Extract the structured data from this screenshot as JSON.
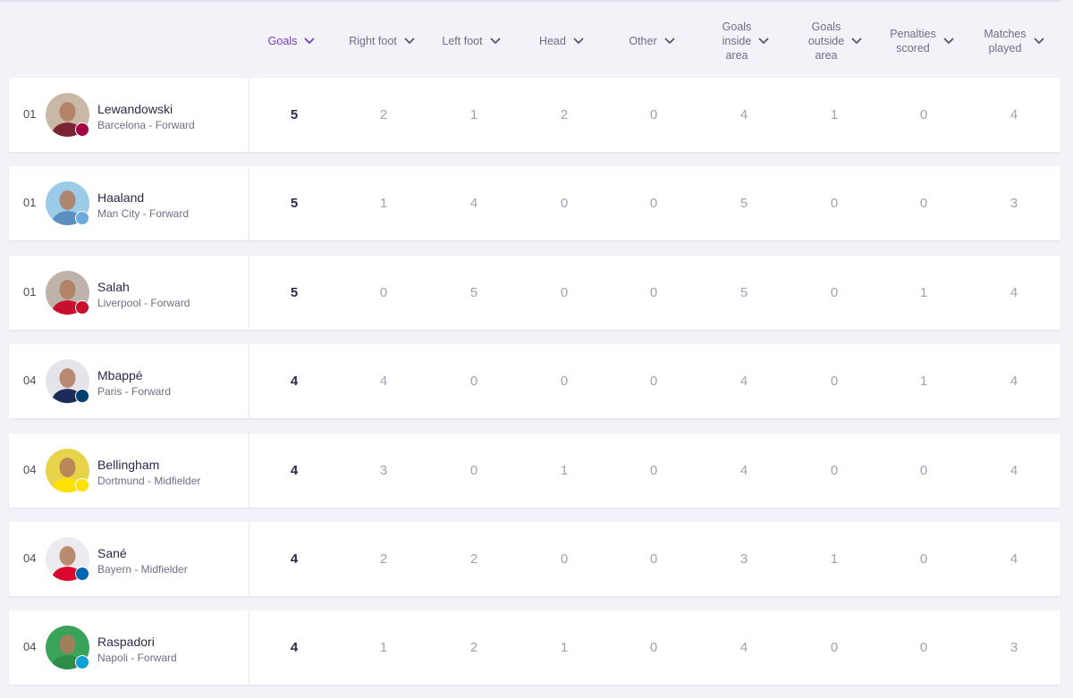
{
  "columns": [
    {
      "key": "goals",
      "label": "Goals",
      "active": true
    },
    {
      "key": "right_foot",
      "label": "Right foot",
      "active": false
    },
    {
      "key": "left_foot",
      "label": "Left foot",
      "active": false
    },
    {
      "key": "head",
      "label": "Head",
      "active": false
    },
    {
      "key": "other",
      "label": "Other",
      "active": false
    },
    {
      "key": "inside",
      "label": "Goals\ninside\narea",
      "active": false
    },
    {
      "key": "outside",
      "label": "Goals\noutside\narea",
      "active": false
    },
    {
      "key": "penalties",
      "label": "Penalties\nscored",
      "active": false
    },
    {
      "key": "matches",
      "label": "Matches\nplayed",
      "active": false
    }
  ],
  "rows": [
    {
      "rank": "01",
      "name": "Lewandowski",
      "team": "Barcelona - Forward",
      "stats": [
        "5",
        "2",
        "1",
        "2",
        "0",
        "4",
        "1",
        "0",
        "4"
      ],
      "avatar_color": "#c9b8a6",
      "shirt_color": "#7a2436",
      "badge_color": "#a50044",
      "badge_icon": "barcelona-crest-icon"
    },
    {
      "rank": "01",
      "name": "Haaland",
      "team": "Man City - Forward",
      "stats": [
        "5",
        "1",
        "4",
        "0",
        "0",
        "5",
        "0",
        "0",
        "3"
      ],
      "avatar_color": "#9ccbe8",
      "shirt_color": "#5b8fc0",
      "badge_color": "#6cabdd",
      "badge_icon": "man-city-crest-icon"
    },
    {
      "rank": "01",
      "name": "Salah",
      "team": "Liverpool - Forward",
      "stats": [
        "5",
        "0",
        "5",
        "0",
        "0",
        "5",
        "0",
        "1",
        "4"
      ],
      "avatar_color": "#bdb3aa",
      "shirt_color": "#c8102e",
      "badge_color": "#c8102e",
      "badge_icon": "liverpool-crest-icon"
    },
    {
      "rank": "04",
      "name": "Mbappé",
      "team": "Paris - Forward",
      "stats": [
        "4",
        "4",
        "0",
        "0",
        "0",
        "4",
        "0",
        "1",
        "4"
      ],
      "avatar_color": "#e4e4ea",
      "shirt_color": "#1d2b5a",
      "badge_color": "#004170",
      "badge_icon": "psg-crest-icon"
    },
    {
      "rank": "04",
      "name": "Bellingham",
      "team": "Dortmund - Midfielder",
      "stats": [
        "4",
        "3",
        "0",
        "1",
        "0",
        "4",
        "0",
        "0",
        "4"
      ],
      "avatar_color": "#e8d44a",
      "shirt_color": "#fde100",
      "badge_color": "#fde100",
      "badge_icon": "dortmund-crest-icon"
    },
    {
      "rank": "04",
      "name": "Sané",
      "team": "Bayern - Midfielder",
      "stats": [
        "4",
        "2",
        "2",
        "0",
        "0",
        "3",
        "1",
        "0",
        "4"
      ],
      "avatar_color": "#ececf0",
      "shirt_color": "#dc052d",
      "badge_color": "#0066b2",
      "badge_icon": "bayern-crest-icon"
    },
    {
      "rank": "04",
      "name": "Raspadori",
      "team": "Napoli - Forward",
      "stats": [
        "4",
        "1",
        "2",
        "1",
        "0",
        "4",
        "0",
        "0",
        "3"
      ],
      "avatar_color": "#3aa35a",
      "shirt_color": "#2e8c4a",
      "badge_color": "#12a0d7",
      "badge_icon": "napoli-crest-icon"
    }
  ]
}
